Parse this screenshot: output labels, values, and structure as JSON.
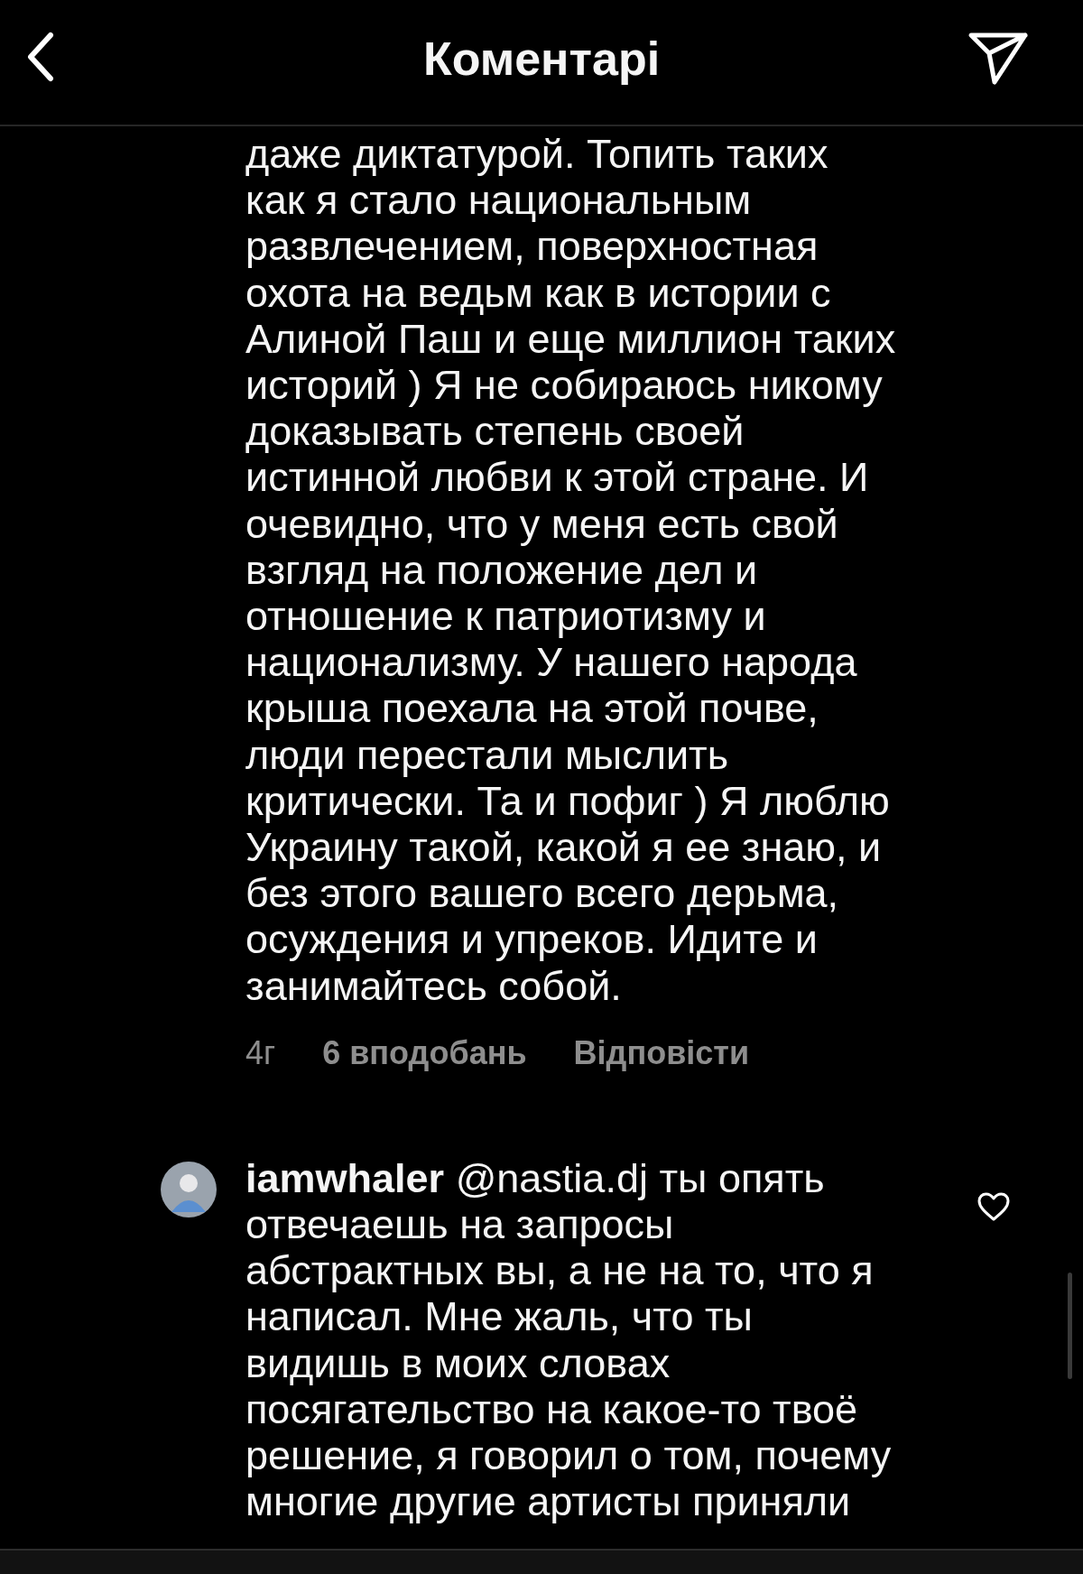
{
  "header": {
    "title": "Коментарі"
  },
  "comments": [
    {
      "lines": [
        "даже диктатурой. Топить таких",
        "как я стало национальным",
        "развлечением, поверхностная",
        "охота на ведьм как в истории с",
        "Алиной Паш и еще миллион таких",
        "историй ) Я не собираюсь никому",
        "доказывать степень своей",
        "истинной любви к  этой стране. И",
        "очевидно, что у меня есть свой",
        "взгляд на положение дел и",
        "отношение к патриотизму и",
        "национализму. У нашего народа",
        "крыша поехала на этой почве,",
        "люди перестали мыслить",
        "критически. Та и пофиг ) Я люблю",
        "Украину такой, какой я ее знаю, и",
        "без этого вашего всего дерьма,",
        "осуждения и упреков. Идите и",
        "занимайтесь собой."
      ],
      "meta": {
        "time": "4г",
        "likes": "6 вподобань",
        "reply": "Відповісти"
      }
    },
    {
      "username": "iamwhaler",
      "mention": "@nastia.dj",
      "lines": [
        "ты опять",
        "отвечаешь на запросы",
        "абстрактных вы, а не на то, что я",
        "написал. Мне жаль, что ты",
        "видишь в моих словах",
        "посягательство на какое-то твоё",
        "решение, я говорил о том, почему",
        "многие другие артисты приняли"
      ],
      "liked": false
    }
  ]
}
